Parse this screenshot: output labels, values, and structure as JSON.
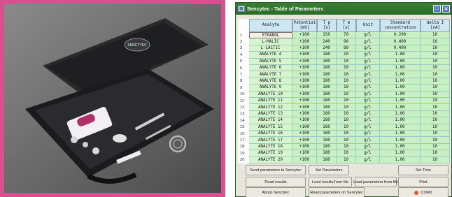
{
  "window": {
    "title": "Sencytec - Table of Parameters",
    "icon": "app-window-icon"
  },
  "table": {
    "headers": [
      "Analyte",
      "Potential\n[mV]",
      "T p\n[s]",
      "T m\n[s]",
      "Unit",
      "Standard\nconcentration",
      "delta I\n[nA]"
    ],
    "rows": [
      {
        "n": "1",
        "analyte": "ETHANOL",
        "potential": "+100",
        "tp": "150",
        "tm": "70",
        "unit": "g/l",
        "std": "0.200",
        "delta": "10"
      },
      {
        "n": "2",
        "analyte": "L-MALIC",
        "potential": "+100",
        "tp": "240",
        "tm": "90",
        "unit": "g/l",
        "std": "0.400",
        "delta": "10"
      },
      {
        "n": "3",
        "analyte": "L-LACTIC",
        "potential": "+100",
        "tp": "240",
        "tm": "80",
        "unit": "g/l",
        "std": "0.400",
        "delta": "10"
      },
      {
        "n": "4",
        "analyte": "ANALYTE 4",
        "potential": "+100",
        "tp": "180",
        "tm": "10",
        "unit": "g/l",
        "std": "1.00",
        "delta": "10"
      },
      {
        "n": "5",
        "analyte": "ANALYTE 5",
        "potential": "+100",
        "tp": "180",
        "tm": "10",
        "unit": "g/l",
        "std": "1.00",
        "delta": "10"
      },
      {
        "n": "6",
        "analyte": "ANALYTE 6",
        "potential": "+100",
        "tp": "180",
        "tm": "10",
        "unit": "g/l",
        "std": "1.00",
        "delta": "10"
      },
      {
        "n": "7",
        "analyte": "ANALYTE 7",
        "potential": "+100",
        "tp": "180",
        "tm": "10",
        "unit": "g/l",
        "std": "1.00",
        "delta": "10"
      },
      {
        "n": "8",
        "analyte": "ANALYTE 8",
        "potential": "+100",
        "tp": "180",
        "tm": "10",
        "unit": "g/l",
        "std": "1.00",
        "delta": "10"
      },
      {
        "n": "9",
        "analyte": "ANALYTE 9",
        "potential": "+100",
        "tp": "180",
        "tm": "10",
        "unit": "g/l",
        "std": "1.00",
        "delta": "10"
      },
      {
        "n": "10",
        "analyte": "ANALYTE 10",
        "potential": "+100",
        "tp": "180",
        "tm": "10",
        "unit": "g/l",
        "std": "1.00",
        "delta": "10"
      },
      {
        "n": "11",
        "analyte": "ANALYTE 11",
        "potential": "+100",
        "tp": "180",
        "tm": "10",
        "unit": "g/l",
        "std": "1.00",
        "delta": "10"
      },
      {
        "n": "12",
        "analyte": "ANALYTE 12",
        "potential": "+100",
        "tp": "180",
        "tm": "10",
        "unit": "g/l",
        "std": "1.00",
        "delta": "10"
      },
      {
        "n": "13",
        "analyte": "ANALYTE 13",
        "potential": "+100",
        "tp": "180",
        "tm": "10",
        "unit": "g/l",
        "std": "1.00",
        "delta": "10"
      },
      {
        "n": "14",
        "analyte": "ANALYTE 14",
        "potential": "+100",
        "tp": "180",
        "tm": "10",
        "unit": "g/l",
        "std": "1.00",
        "delta": "10"
      },
      {
        "n": "15",
        "analyte": "ANALYTE 15",
        "potential": "+100",
        "tp": "180",
        "tm": "10",
        "unit": "g/l",
        "std": "1.00",
        "delta": "10"
      },
      {
        "n": "16",
        "analyte": "ANALYTE 16",
        "potential": "+100",
        "tp": "180",
        "tm": "10",
        "unit": "g/l",
        "std": "1.00",
        "delta": "10"
      },
      {
        "n": "17",
        "analyte": "ANALYTE 17",
        "potential": "+100",
        "tp": "180",
        "tm": "10",
        "unit": "g/l",
        "std": "1.00",
        "delta": "10"
      },
      {
        "n": "18",
        "analyte": "ANALYTE 18",
        "potential": "+100",
        "tp": "180",
        "tm": "10",
        "unit": "g/l",
        "std": "1.00",
        "delta": "10"
      },
      {
        "n": "19",
        "analyte": "ANALYTE 19",
        "potential": "+100",
        "tp": "180",
        "tm": "10",
        "unit": "g/l",
        "std": "1.00",
        "delta": "10"
      },
      {
        "n": "20",
        "analyte": "ANALYTE 20",
        "potential": "+100",
        "tp": "180",
        "tm": "10",
        "unit": "g/l",
        "std": "1.00",
        "delta": "10"
      }
    ]
  },
  "buttons": {
    "send_params": "Send parameters to Sencytec",
    "set_params": "Set Parameters",
    "set_time": "Set Time",
    "read_results": "Read results",
    "load_results": "Load results from file",
    "load_params": "Load parameters from file",
    "print": "Print",
    "about": "About Sencytec",
    "read_params": "Read parameters on Sencytec",
    "com_port": "COM2"
  },
  "photo": {
    "case_logo": "SENCYTEC"
  },
  "colors": {
    "frame": "#d8508f",
    "titlebar": "#2f7430",
    "cell_green": "#c8f0c4",
    "header_blue": "#cde6f2"
  }
}
